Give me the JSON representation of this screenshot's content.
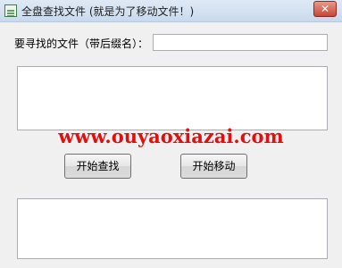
{
  "window": {
    "title": "全盘查找文件 (就是为了移动文件！)",
    "app_icon": "app-icon",
    "close_glyph": "✕"
  },
  "form": {
    "filename_label": "要寻找的文件（带后缀名）：",
    "filename_value": ""
  },
  "watermark": "www.ouyaoxiazai.com",
  "buttons": {
    "search_label": "开始查找",
    "move_label": "开始移动"
  },
  "colors": {
    "watermark": "#e0100e"
  }
}
